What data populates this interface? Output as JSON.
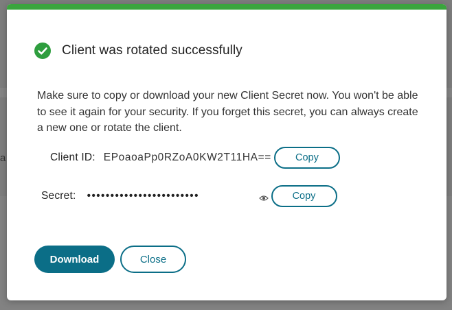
{
  "colors": {
    "accent": "#0b6e87",
    "success": "#2e9e3e",
    "top_bar": "#3aa53d"
  },
  "background": {
    "edge_text": "a"
  },
  "dialog": {
    "title": "Client was rotated successfully",
    "status_icon": "check-circle-icon",
    "message": "Make sure to copy or download your new Client Secret now. You won't be able to see it again for your security. If you forget this secret, you can always create a new one or rotate the client.",
    "client_id": {
      "label": "Client ID:",
      "value": "EPoaoaPp0RZoA0KW2T11HA==",
      "copy_label": "Copy"
    },
    "secret": {
      "label": "Secret:",
      "value": "••••••••••••••••••••••••",
      "reveal_icon": "eye-icon",
      "copy_label": "Copy"
    },
    "actions": {
      "download_label": "Download",
      "close_label": "Close"
    }
  }
}
